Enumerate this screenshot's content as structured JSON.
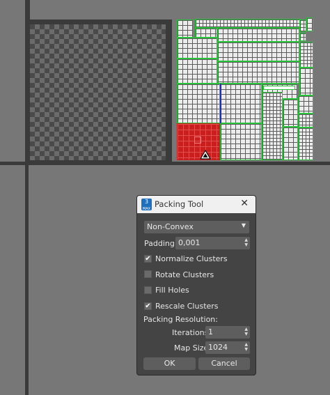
{
  "dialog": {
    "title": "Packing Tool",
    "app_icon_text": "3",
    "method_select": "Non-Convex",
    "padding_label": "Padding:",
    "padding_value": "0,001",
    "normalize_label": "Normalize Clusters",
    "normalize_checked": true,
    "rotate_label": "Rotate Clusters",
    "rotate_checked": false,
    "fillholes_label": "Fill Holes",
    "fillholes_checked": false,
    "rescale_label": "Rescale Clusters",
    "rescale_checked": true,
    "resolution_label": "Packing Resolution:",
    "iterations_label": "Iterations:",
    "iterations_value": "1",
    "mapsize_label": "Map Size:",
    "mapsize_value": "1024",
    "ok_label": "OK",
    "cancel_label": "Cancel"
  },
  "icons": {
    "close": "close-icon",
    "dropdown": "chevron-down-icon",
    "spinner": "spinner-arrows-icon",
    "check": "checkmark-icon",
    "warning": "warning-triangle-icon",
    "app": "3dsmax-app-icon"
  },
  "colors": {
    "uv_fill": "#ececec",
    "uv_border": "#28c43a",
    "selected_uv": "#c81e1e",
    "dialog_bg": "#444444",
    "viewport_bg": "#777777"
  }
}
